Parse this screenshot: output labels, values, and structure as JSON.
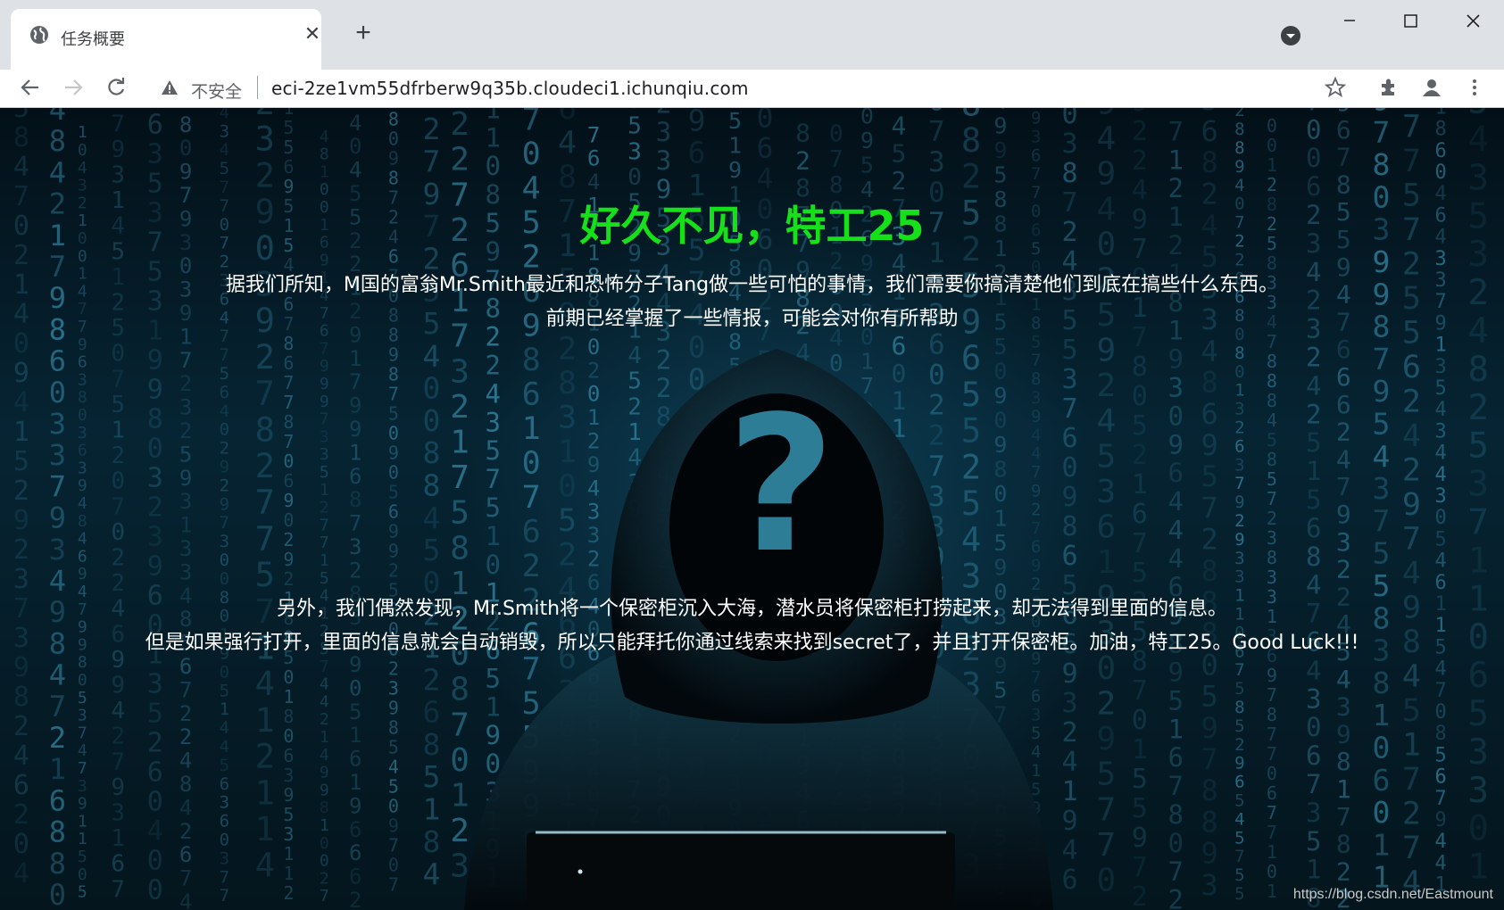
{
  "browser": {
    "tab_title": "任务概要",
    "tab_close": "✕",
    "new_tab": "+",
    "security_label": "不安全",
    "url": "eci-2ze1vm55dfrberw9q35b.cloudeci1.ichunqiu.com",
    "icons": [
      "globe-icon",
      "back-icon",
      "forward-icon",
      "reload-icon",
      "warning-icon",
      "star-icon",
      "extensions-icon",
      "profile-icon",
      "menu-icon",
      "minimize-icon",
      "maximize-icon",
      "close-icon"
    ]
  },
  "page": {
    "title": "好久不见，特工25",
    "intro_line1": "据我们所知，M国的富翁Mr.Smith最近和恐怖分子Tang做一些可怕的事情，我们需要你搞清楚他们到底在搞些什么东西。",
    "intro_line2": "前期已经掌握了一些情报，可能会对你有所帮助",
    "mission_line1": "另外，我们偶然发现，Mr.Smith将一个保密柜沉入大海，潜水员将保密柜打捞起来，却无法得到里面的信息。",
    "mission_line2": "但是如果强行打开，里面的信息就会自动销毁，所以只能拜托你通过线索来找到secret了，并且打开保密柜。加油，特工25。Good Luck!!!",
    "background_mark": "?",
    "watermark": "https://blog.csdn.net/Eastmount"
  },
  "colors": {
    "title_green": "#16e01a",
    "text_white": "#ffffff",
    "bg_dark": "#031018",
    "accent_teal": "#2d7d96"
  }
}
